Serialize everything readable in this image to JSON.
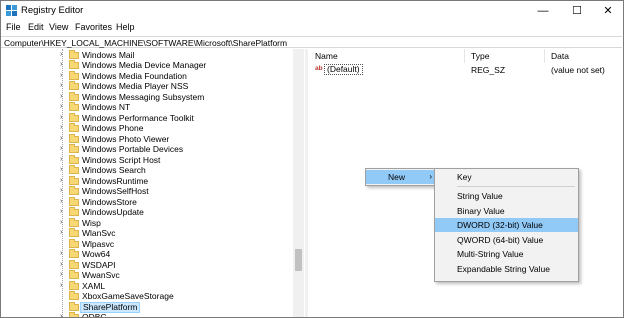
{
  "window": {
    "title": "Registry Editor",
    "controls": {
      "minimize": "—",
      "maximize": "☐",
      "close": "✕"
    }
  },
  "menu": [
    "File",
    "Edit",
    "View",
    "Favorites",
    "Help"
  ],
  "address": "Computer\\HKEY_LOCAL_MACHINE\\SOFTWARE\\Microsoft\\SharePlatform",
  "tree": {
    "items": [
      {
        "label": "Windows Mail",
        "expander": "›"
      },
      {
        "label": "Windows Media Device Manager",
        "expander": "›"
      },
      {
        "label": "Windows Media Foundation",
        "expander": "›"
      },
      {
        "label": "Windows Media Player NSS",
        "expander": "›"
      },
      {
        "label": "Windows Messaging Subsystem",
        "expander": "›"
      },
      {
        "label": "Windows NT",
        "expander": "›"
      },
      {
        "label": "Windows Performance Toolkit",
        "expander": "›"
      },
      {
        "label": "Windows Phone",
        "expander": "›"
      },
      {
        "label": "Windows Photo Viewer",
        "expander": "›"
      },
      {
        "label": "Windows Portable Devices",
        "expander": "›"
      },
      {
        "label": "Windows Script Host",
        "expander": "›"
      },
      {
        "label": "Windows Search",
        "expander": "›"
      },
      {
        "label": "WindowsRuntime",
        "expander": "›"
      },
      {
        "label": "WindowsSelfHost",
        "expander": "›"
      },
      {
        "label": "WindowsStore",
        "expander": "›"
      },
      {
        "label": "WindowsUpdate",
        "expander": "›"
      },
      {
        "label": "Wisp",
        "expander": "›"
      },
      {
        "label": "WlanSvc",
        "expander": "›"
      },
      {
        "label": "Wlpasvc",
        "expander": ""
      },
      {
        "label": "Wow64",
        "expander": "›"
      },
      {
        "label": "WSDAPI",
        "expander": "›"
      },
      {
        "label": "WwanSvc",
        "expander": "›"
      },
      {
        "label": "XAML",
        "expander": "›"
      },
      {
        "label": "XboxGameSaveStorage",
        "expander": ""
      },
      {
        "label": "SharePlatform",
        "expander": "",
        "selected": true
      },
      {
        "label": "ODBC",
        "expander": "›"
      }
    ]
  },
  "list": {
    "columns": [
      "Name",
      "Type",
      "Data"
    ],
    "rows": [
      {
        "icon": "ab",
        "name": "(Default)",
        "type": "REG_SZ",
        "data": "(value not set)"
      }
    ]
  },
  "context_menu": {
    "new_label": "New",
    "new_chevron": "›"
  },
  "submenu": {
    "items": [
      "Key",
      "String Value",
      "Binary Value",
      "DWORD (32-bit) Value",
      "QWORD (64-bit) Value",
      "Multi-String Value",
      "Expandable String Value"
    ],
    "highlighted": "DWORD (32-bit) Value"
  },
  "colors": {
    "highlight": "#91c9f7",
    "selection": "#cce8ff",
    "folder": "#f8d775"
  }
}
